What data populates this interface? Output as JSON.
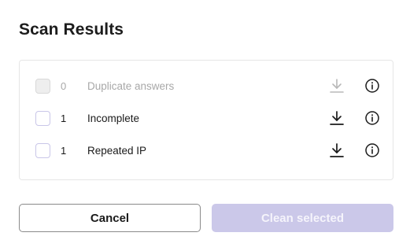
{
  "dialog": {
    "title": "Scan Results"
  },
  "results": [
    {
      "count": "0",
      "label": "Duplicate answers",
      "disabled": true
    },
    {
      "count": "1",
      "label": "Incomplete",
      "disabled": false
    },
    {
      "count": "1",
      "label": "Repeated IP",
      "disabled": false
    }
  ],
  "icons": {
    "download": "download-icon",
    "info": "info-icon"
  },
  "buttons": {
    "cancel_label": "Cancel",
    "clean_label": "Clean selected"
  },
  "colors": {
    "checkbox_border": "#c9c6e8",
    "clean_button_bg": "#cbc8e9",
    "disabled_text": "#a8a8a8"
  }
}
